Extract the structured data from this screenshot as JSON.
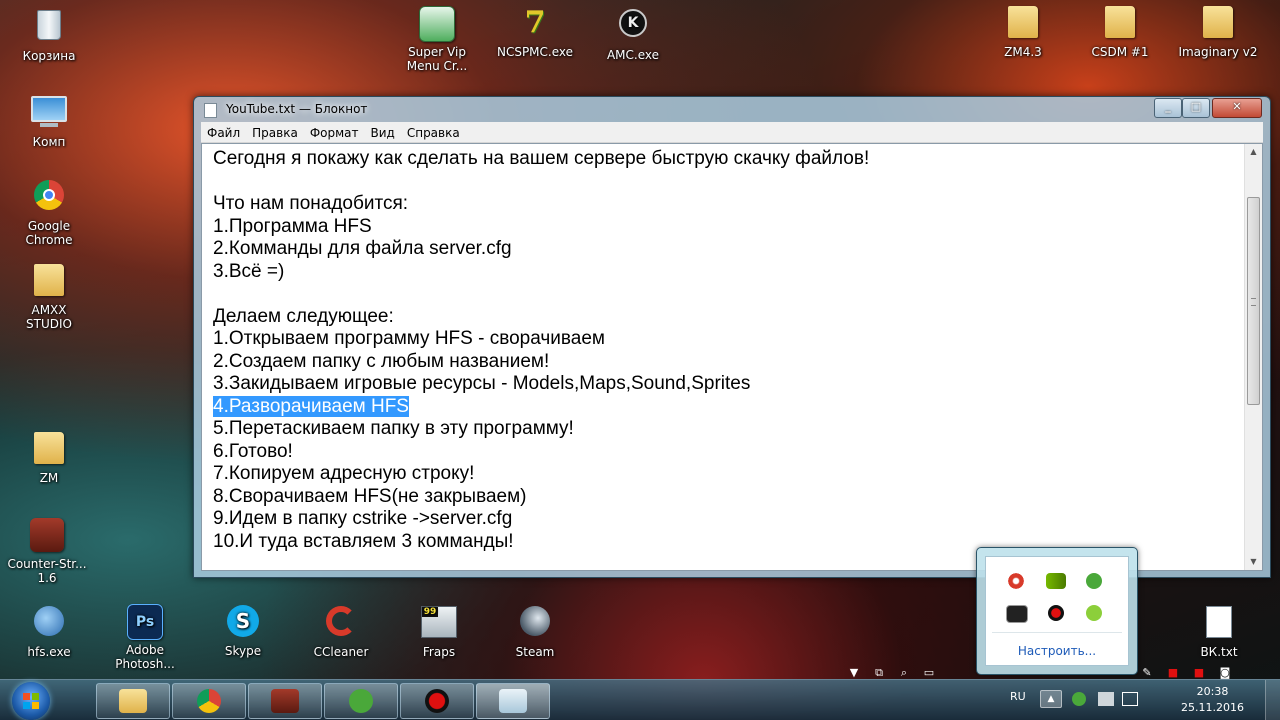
{
  "desktop": {
    "icons_left": [
      {
        "label": "Корзина",
        "icon": "recycle-bin-icon"
      },
      {
        "label": "Комп",
        "icon": "computer-icon"
      },
      {
        "label": "Google Chrome",
        "icon": "chrome-icon"
      },
      {
        "label": "AMXX STUDIO",
        "icon": "folder-icon"
      },
      {
        "label": "ZM",
        "icon": "folder-icon"
      },
      {
        "label": "Counter-Str... 1.6",
        "icon": "counter-strike-icon"
      }
    ],
    "icons_top": [
      {
        "label": "Super Vip Menu Cr...",
        "icon": "app-icon"
      },
      {
        "label": "NCSPMC.exe",
        "icon": "ncs-icon"
      },
      {
        "label": "AMC.exe",
        "icon": "amc-icon"
      }
    ],
    "icons_top_right": [
      {
        "label": "ZM4.3",
        "icon": "folder-icon"
      },
      {
        "label": "CSDM #1",
        "icon": "folder-icon"
      },
      {
        "label": "Imaginary v2",
        "icon": "folder-icon"
      }
    ],
    "icons_bottom": [
      {
        "label": "hfs.exe",
        "icon": "hfs-icon"
      },
      {
        "label": "Adobe Photosh...",
        "icon": "photoshop-icon"
      },
      {
        "label": "Skype",
        "icon": "skype-icon"
      },
      {
        "label": "CCleaner",
        "icon": "ccleaner-icon"
      },
      {
        "label": "Fraps",
        "icon": "fraps-icon"
      },
      {
        "label": "Steam",
        "icon": "steam-icon"
      }
    ],
    "icon_bottom_right": {
      "label": "ВК.txt",
      "icon": "text-file-icon"
    }
  },
  "notepad": {
    "title": "YouTube.txt — Блокнот",
    "menu": [
      "Файл",
      "Правка",
      "Формат",
      "Вид",
      "Справка"
    ],
    "lines": [
      "Сегодня я покажу как сделать на вашем сервере быструю скачку файлов!",
      "",
      "Что нам понадобится:",
      "1.Программа HFS",
      "2.Комманды для файла server.cfg",
      "3.Всё =)",
      "",
      "Делаем следующее:",
      "1.Открываем программу HFS - сворачиваем",
      "2.Создаем папку с любым названием!",
      "3.Закидываем игровые ресурсы - Models,Maps,Sound,Sprites",
      "4.Разворачиваем HFS",
      "5.Перетаскиваем папку в эту программу!",
      "6.Готово!",
      "7.Копируем адресную строку!",
      "8.Сворачиваем HFS(не закрываем)",
      "9.Идем в папку cstrike ->server.cfg",
      "10.И туда вставляем 3 комманды!"
    ],
    "selected_line_index": 11,
    "selection_color": "#3399ff"
  },
  "tray_popup": {
    "customize_label": "Настроить..."
  },
  "taskbar": {
    "language": "RU",
    "time": "20:38",
    "date": "25.11.2016"
  }
}
